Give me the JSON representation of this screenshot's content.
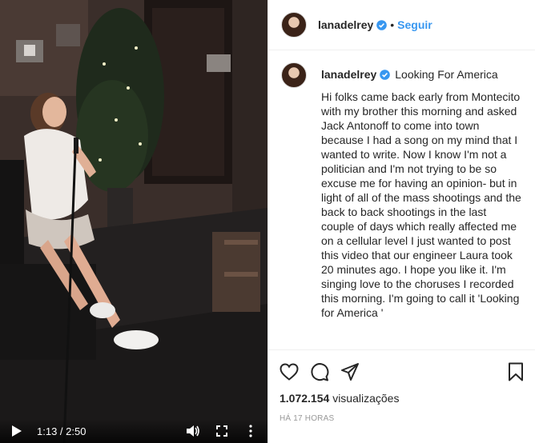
{
  "post": {
    "username": "lanadelrey",
    "follow_label": "Seguir",
    "separator": "•",
    "caption_heading": "Looking For America",
    "caption": "Hi folks came back early from Montecito with my brother this morning and asked Jack Antonoff to come into town because I had a song on my mind that I wanted to write. Now I know I'm not a politician and I'm not trying to be so excuse me for having an opinion- but in light of all of the mass shootings and the back to back shootings in the last couple of days which really affected me on a cellular level I just wanted to post this video that our engineer Laura took 20 minutes ago. I hope you like it. I'm singing love to the choruses I recorded this morning. I'm going to call it 'Looking for America '",
    "views_count": "1.072.154",
    "views_label": "visualizações",
    "time_ago": "HÁ 17 HORAS"
  },
  "video": {
    "current_time": "1:13",
    "duration": "2:50",
    "time_separator": " / "
  },
  "icons": {
    "like": "heart-icon",
    "comment": "comment-icon",
    "share": "share-icon",
    "save": "bookmark-icon",
    "verified": "verified-badge-icon",
    "play": "play-icon",
    "volume": "volume-icon",
    "fullscreen": "fullscreen-icon",
    "more": "more-icon"
  },
  "colors": {
    "link_blue": "#3897f0",
    "verified_blue": "#3897f0",
    "text": "#262626",
    "muted": "#999999"
  }
}
